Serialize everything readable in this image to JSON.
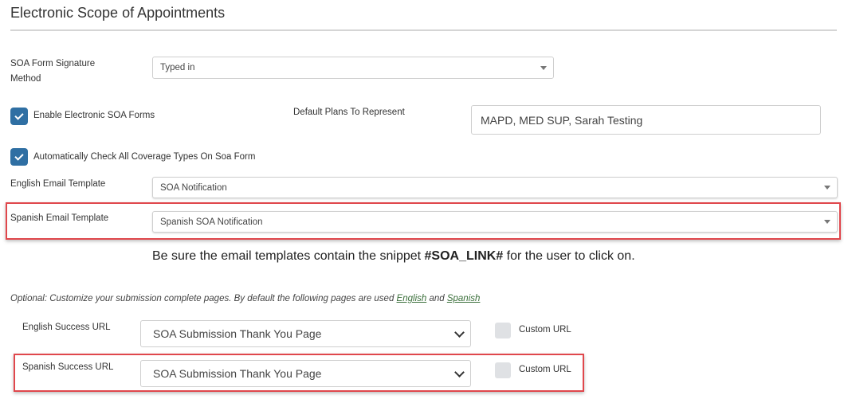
{
  "page": {
    "title": "Electronic Scope of Appointments"
  },
  "signature": {
    "label_line1": "SOA Form Signature",
    "label_line2": "Method",
    "value": "Typed in"
  },
  "enable_soa": {
    "label": "Enable Electronic SOA Forms",
    "checked": true
  },
  "default_plans": {
    "label": "Default Plans To Represent",
    "value": "MAPD, MED SUP, Sarah Testing"
  },
  "auto_check": {
    "label": "Automatically Check All Coverage Types On Soa Form",
    "checked": true
  },
  "english_template": {
    "label": "English Email Template",
    "value": "SOA Notification"
  },
  "spanish_template": {
    "label": "Spanish Email Template",
    "value": "Spanish SOA Notification"
  },
  "note": {
    "prefix": "Be sure the email templates contain the snippet ",
    "snippet": "#SOA_LINK#",
    "suffix": " for the user to click on."
  },
  "optional": {
    "text": "Optional: Customize your submission complete pages. By default the following pages are used ",
    "link_english": "English",
    "and": " and ",
    "link_spanish": "Spanish"
  },
  "english_success": {
    "label": "English Success URL",
    "value": "SOA Submission Thank You Page",
    "custom_label": "Custom URL"
  },
  "spanish_success": {
    "label": "Spanish Success URL",
    "value": "SOA Submission Thank You Page",
    "custom_label": "Custom URL"
  },
  "colors": {
    "accent": "#2f6fa3",
    "highlight": "#e0474c",
    "link": "#3a6f3a"
  }
}
